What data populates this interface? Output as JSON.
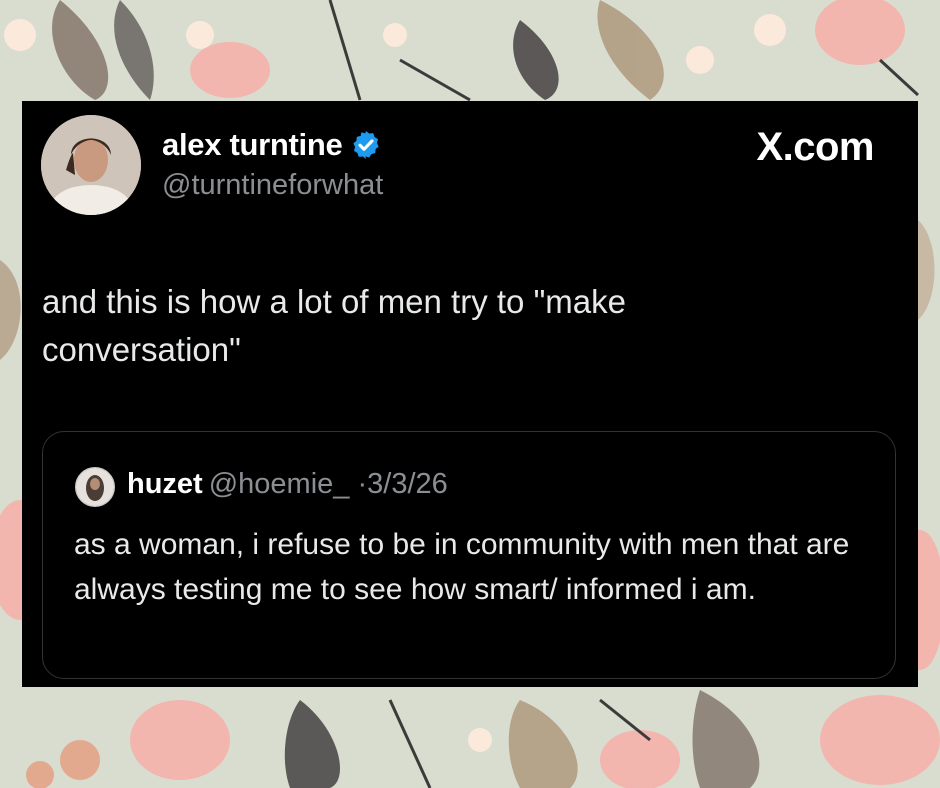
{
  "tweet": {
    "author_name": "alex turntine",
    "author_handle": "@turntineforwhat",
    "brand": "X.com",
    "text": "and this is how a lot of men try to \"make conversation\""
  },
  "quoted_tweet": {
    "author_name": "huzet",
    "author_handle": "@hoemie_",
    "separator": "·",
    "date": "3/3/26",
    "text": "as a woman, i refuse to be in community with men that are always testing me to see how smart/ informed i am."
  },
  "colors": {
    "card_background": "#000000",
    "text_primary": "#e7e9ea",
    "text_secondary": "#8b8f94",
    "verified_badge": "#1d9bf0",
    "page_background": "#d8ddd0"
  },
  "icons": {
    "verified": "verified-badge-icon",
    "brand": "x-logo-icon"
  }
}
